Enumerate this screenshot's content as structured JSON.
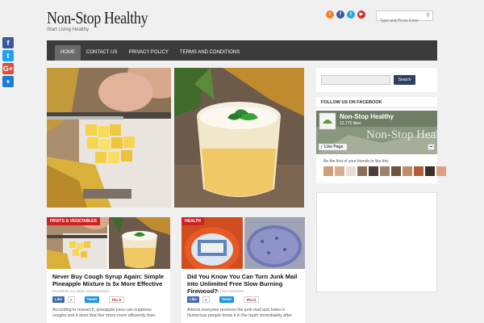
{
  "share_bar": [
    {
      "icon": "facebook-icon",
      "glyph": "f",
      "color": "#3b5998"
    },
    {
      "icon": "twitter-icon",
      "glyph": "t",
      "color": "#1da1f2"
    },
    {
      "icon": "google-plus-icon",
      "glyph": "G+",
      "color": "#dd4b39"
    },
    {
      "icon": "share-plus-icon",
      "glyph": "+",
      "color": "#1a7cd1"
    }
  ],
  "header": {
    "title": "Non-Stop Healthy",
    "tagline": "Start Living Healthy",
    "search_placeholder": "Type and Press Enter",
    "icons": [
      {
        "name": "rss-icon",
        "glyph": "r",
        "color": "#f0802a"
      },
      {
        "name": "facebook-icon",
        "glyph": "f",
        "color": "#3b5998"
      },
      {
        "name": "twitter-icon",
        "glyph": "t",
        "color": "#2aa9e0"
      },
      {
        "name": "youtube-icon",
        "glyph": "▶",
        "color": "#d3281f"
      }
    ]
  },
  "nav": {
    "items": [
      "HOME",
      "CONTACT US",
      "PRIVACY POLICY",
      "TERMS AND CONDITIONS"
    ]
  },
  "posts": [
    {
      "category": "FRUITS & VEGETABLES",
      "title": "Never Buy Cough Syrup Again: Simple Pineapple Mixture Is 5x More Effective",
      "meta": "December 14, 2015  |  No Comment",
      "like": "Like",
      "like_count": "2",
      "tweet": "Tweet",
      "pin": "Pin it",
      "excerpt": "According to research, pineapple juice can suppress coughs and it does that five times more efficiently than"
    },
    {
      "category": "HEALTH",
      "title": "Did You Know You Can Turn Junk Mail Into Unlimited Free Slow Burning Firewood?",
      "meta": "December 14, 2015  |  No Comment",
      "like": "Like",
      "like_count": "2",
      "tweet": "Tweet",
      "pin": "Pin it",
      "excerpt": "Almost everyone receives the junk mail and hates it. Numerous people throw it in the trash immediately after"
    }
  ],
  "sidebar": {
    "search_button": "Search",
    "facebook_header": "FOLLOW US ON FACEBOOK",
    "page_name": "Non-Stop Healthy",
    "likes": "12,775 likes",
    "like_page": "Like Page",
    "cover_text": "Non-Stop Healt",
    "friends_text": "Be the first of your friends to like this"
  }
}
